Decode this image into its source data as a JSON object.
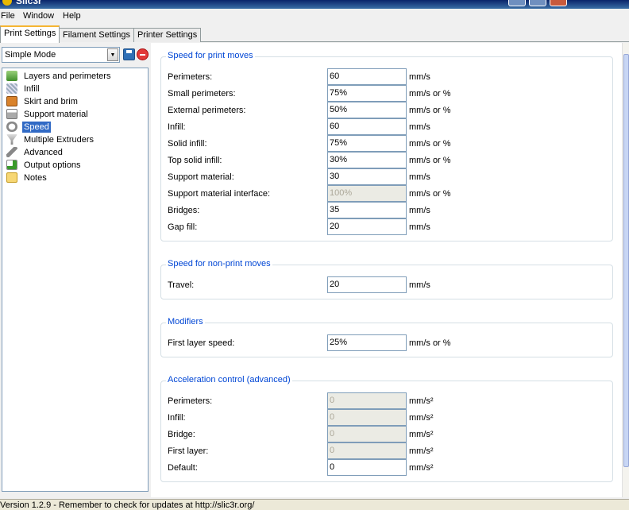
{
  "window": {
    "title": "Slic3r"
  },
  "menu": [
    "File",
    "Window",
    "Help"
  ],
  "tabs": [
    "Print Settings",
    "Filament Settings",
    "Printer Settings"
  ],
  "preset": {
    "selected": "Simple Mode"
  },
  "tree": [
    {
      "label": "Layers and perimeters",
      "icon": "layers-icon"
    },
    {
      "label": "Infill",
      "icon": "infill-icon"
    },
    {
      "label": "Skirt and brim",
      "icon": "skirt-icon"
    },
    {
      "label": "Support material",
      "icon": "support-icon"
    },
    {
      "label": "Speed",
      "icon": "speed-icon",
      "selected": true
    },
    {
      "label": "Multiple Extruders",
      "icon": "funnel-icon"
    },
    {
      "label": "Advanced",
      "icon": "wrench-icon"
    },
    {
      "label": "Output options",
      "icon": "output-icon"
    },
    {
      "label": "Notes",
      "icon": "note-icon"
    }
  ],
  "groups": {
    "print_moves": {
      "title": "Speed for print moves",
      "rows": [
        {
          "label": "Perimeters:",
          "value": "60",
          "unit": "mm/s"
        },
        {
          "label": "Small perimeters:",
          "value": "75%",
          "unit": "mm/s or %"
        },
        {
          "label": "External perimeters:",
          "value": "50%",
          "unit": "mm/s or %"
        },
        {
          "label": "Infill:",
          "value": "60",
          "unit": "mm/s"
        },
        {
          "label": "Solid infill:",
          "value": "75%",
          "unit": "mm/s or %"
        },
        {
          "label": "Top solid infill:",
          "value": "30%",
          "unit": "mm/s or %"
        },
        {
          "label": "Support material:",
          "value": "30",
          "unit": "mm/s"
        },
        {
          "label": "Support material interface:",
          "value": "100%",
          "unit": "mm/s or %",
          "disabled": true
        },
        {
          "label": "Bridges:",
          "value": "35",
          "unit": "mm/s"
        },
        {
          "label": "Gap fill:",
          "value": "20",
          "unit": "mm/s"
        }
      ]
    },
    "non_print": {
      "title": "Speed for non-print moves",
      "rows": [
        {
          "label": "Travel:",
          "value": "20",
          "unit": "mm/s"
        }
      ]
    },
    "modifiers": {
      "title": "Modifiers",
      "rows": [
        {
          "label": "First layer speed:",
          "value": "25%",
          "unit": "mm/s or %"
        }
      ]
    },
    "acceleration": {
      "title": "Acceleration control (advanced)",
      "rows": [
        {
          "label": "Perimeters:",
          "value": "0",
          "unit": "mm/s²",
          "disabled": true
        },
        {
          "label": "Infill:",
          "value": "0",
          "unit": "mm/s²",
          "disabled": true
        },
        {
          "label": "Bridge:",
          "value": "0",
          "unit": "mm/s²",
          "disabled": true
        },
        {
          "label": "First layer:",
          "value": "0",
          "unit": "mm/s²",
          "disabled": true
        },
        {
          "label": "Default:",
          "value": "0",
          "unit": "mm/s²"
        }
      ]
    }
  },
  "status": "Version 1.2.9 - Remember to check for updates at http://slic3r.org/"
}
